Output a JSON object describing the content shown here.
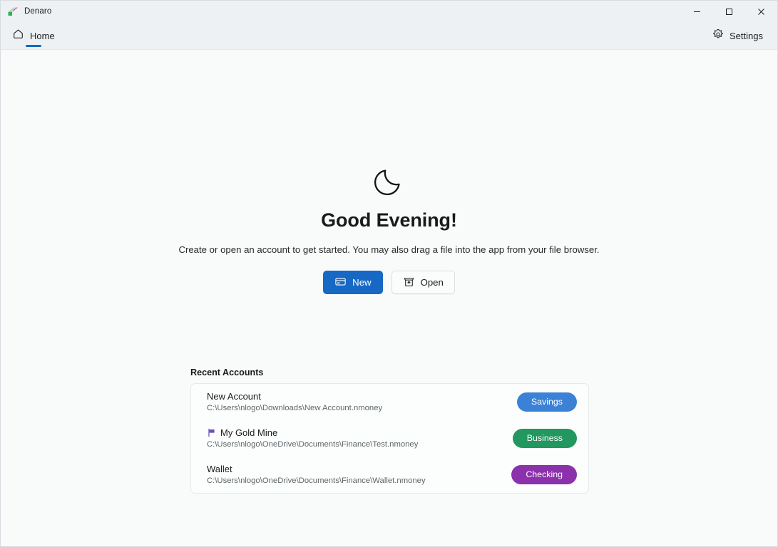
{
  "titlebar": {
    "app_icon": "denaro-app-icon",
    "title": "Denaro",
    "minimize_label": "–",
    "maximize_label": "□",
    "close_label": "✕"
  },
  "navbar": {
    "home_tab": {
      "icon": "home-icon",
      "label": "Home"
    },
    "settings": {
      "icon": "gear-icon",
      "label": "Settings"
    }
  },
  "hero": {
    "icon": "crescent-moon-icon",
    "greeting": "Good Evening!",
    "subtitle": "Create or open an account to get started. You may also drag a file into the app from your file browser.",
    "buttons": [
      {
        "label": "New",
        "icon": "credit-card-icon",
        "style": "primary"
      },
      {
        "label": "Open",
        "icon": "open-folder-icon",
        "style": "secondary"
      }
    ]
  },
  "recent": {
    "heading": "Recent Accounts",
    "accounts": [
      {
        "name": "New Account",
        "path": "C:\\Users\\nlogo\\Downloads\\New Account.nmoney",
        "flag": false,
        "badge": {
          "label": "Savings",
          "color": "#3b82d6"
        }
      },
      {
        "name": "My Gold Mine",
        "path": "C:\\Users\\nlogo\\OneDrive\\Documents\\Finance\\Test.nmoney",
        "flag": true,
        "flag_icon": "flag-icon",
        "flag_color": "#6b4fbb",
        "badge": {
          "label": "Business",
          "color": "#22975f"
        }
      },
      {
        "name": "Wallet",
        "path": "C:\\Users\\nlogo\\OneDrive\\Documents\\Finance\\Wallet.nmoney",
        "flag": false,
        "badge": {
          "label": "Checking",
          "color": "#8b31ac"
        }
      }
    ]
  },
  "colors": {
    "accent": "#1668c4",
    "titlebar_bg": "#eef1f3",
    "content_bg": "#f9fafa",
    "card_bg": "#fcfdfd"
  }
}
